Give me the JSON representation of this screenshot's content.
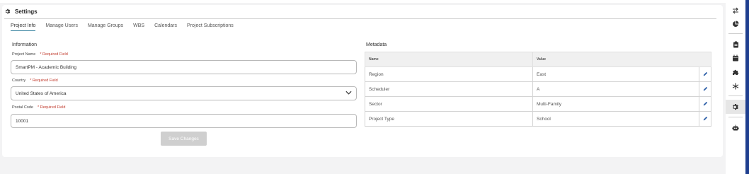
{
  "header": {
    "title": "Settings",
    "icon": "gear-icon"
  },
  "tabs": [
    {
      "label": "Project Info",
      "active": true
    },
    {
      "label": "Manage Users",
      "active": false
    },
    {
      "label": "Manage Groups",
      "active": false
    },
    {
      "label": "WBS",
      "active": false
    },
    {
      "label": "Calendars",
      "active": false
    },
    {
      "label": "Project Subscriptions",
      "active": false
    }
  ],
  "information": {
    "title": "Information",
    "project_name": {
      "label": "Project Name",
      "required": "* Required Field",
      "value": "SmartPM - Academic Building"
    },
    "country": {
      "label": "Country",
      "required": "* Required Field",
      "value": "United States of America"
    },
    "postal_code": {
      "label": "Postal Code",
      "required": "* Required Field",
      "value": "10001"
    },
    "save_label": "Save Changes"
  },
  "metadata": {
    "title": "Metadata",
    "columns": [
      "Name",
      "Value"
    ],
    "rows": [
      {
        "name": "Region",
        "value": "East"
      },
      {
        "name": "Scheduler",
        "value": "A"
      },
      {
        "name": "Sector",
        "value": "Multi-Family"
      },
      {
        "name": "Project Type",
        "value": "School"
      }
    ]
  },
  "sidebar": {
    "icons": [
      "swap-arrows-icon",
      "pie-chart-icon",
      "clipboard-icon",
      "calendar-icon",
      "puzzle-icon",
      "snowflake-icon",
      "gear-icon",
      "robot-icon"
    ],
    "active": "gear-icon",
    "accent": "#1f3f8f"
  },
  "colors": {
    "tab_underline": "#2e7d9b",
    "required": "#c0392b",
    "edit_icon": "#2d5fa8"
  }
}
